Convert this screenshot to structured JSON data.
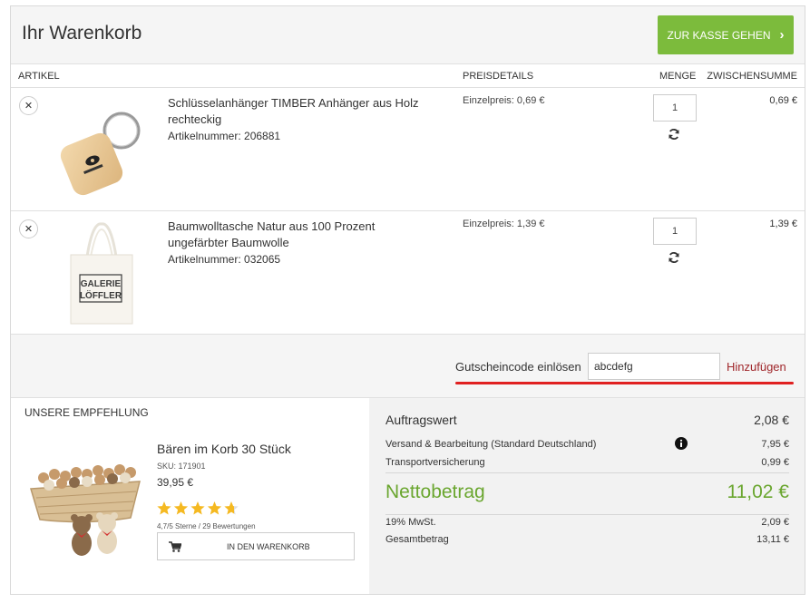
{
  "header": {
    "title": "Ihr Warenkorb",
    "checkout_label": "ZUR KASSE GEHEN"
  },
  "columns": {
    "article": "ARTIKEL",
    "price_details": "PREISDETAILS",
    "quantity": "MENGE",
    "subtotal": "ZWISCHENSUMME"
  },
  "items": [
    {
      "name": "Schlüsselanhänger TIMBER Anhänger aus Holz rechteckig",
      "sku": "Artikelnummer: 206881",
      "unit_price": "Einzelpreis: 0,69 €",
      "quantity": "1",
      "subtotal": "0,69 €",
      "image_icon": "keychain-icon"
    },
    {
      "name": "Baumwolltasche Natur aus 100 Prozent ungefärbter Baumwolle",
      "sku": "Artikelnummer: 032065",
      "unit_price": "Einzelpreis: 1,39 €",
      "quantity": "1",
      "subtotal": "1,39 €",
      "image_icon": "tote-bag-icon",
      "image_print": [
        "GALERIE",
        "LÖFFLER"
      ]
    }
  ],
  "voucher": {
    "label": "Gutscheincode einlösen",
    "value": "abcdefg",
    "add_label": "Hinzufügen"
  },
  "recommendation": {
    "title": "UNSERE EMPFEHLUNG",
    "name": "Bären im Korb 30 Stück",
    "sku": "SKU: 171901",
    "price": "39,95 €",
    "rating": 4.7,
    "rating_text": "4,7/5 Sterne / 29 Bewertungen",
    "add_label": "IN DEN WARENKORB"
  },
  "summary": {
    "order_value_label": "Auftragswert",
    "order_value": "2,08 €",
    "shipping_label": "Versand & Bearbeitung (Standard Deutschland)",
    "shipping": "7,95 €",
    "insurance_label": "Transportversicherung",
    "insurance": "0,99 €",
    "net_label": "Nettobetrag",
    "net": "11,02 €",
    "vat_label": "19% MwSt.",
    "vat": "2,09 €",
    "total_label": "Gesamtbetrag",
    "total": "13,11 €"
  },
  "colors": {
    "accent_green": "#7cbb3c",
    "net_green": "#6aa62f",
    "link_red": "#a0272b",
    "underline_red": "#e02020",
    "star_gold": "#f5b921"
  }
}
